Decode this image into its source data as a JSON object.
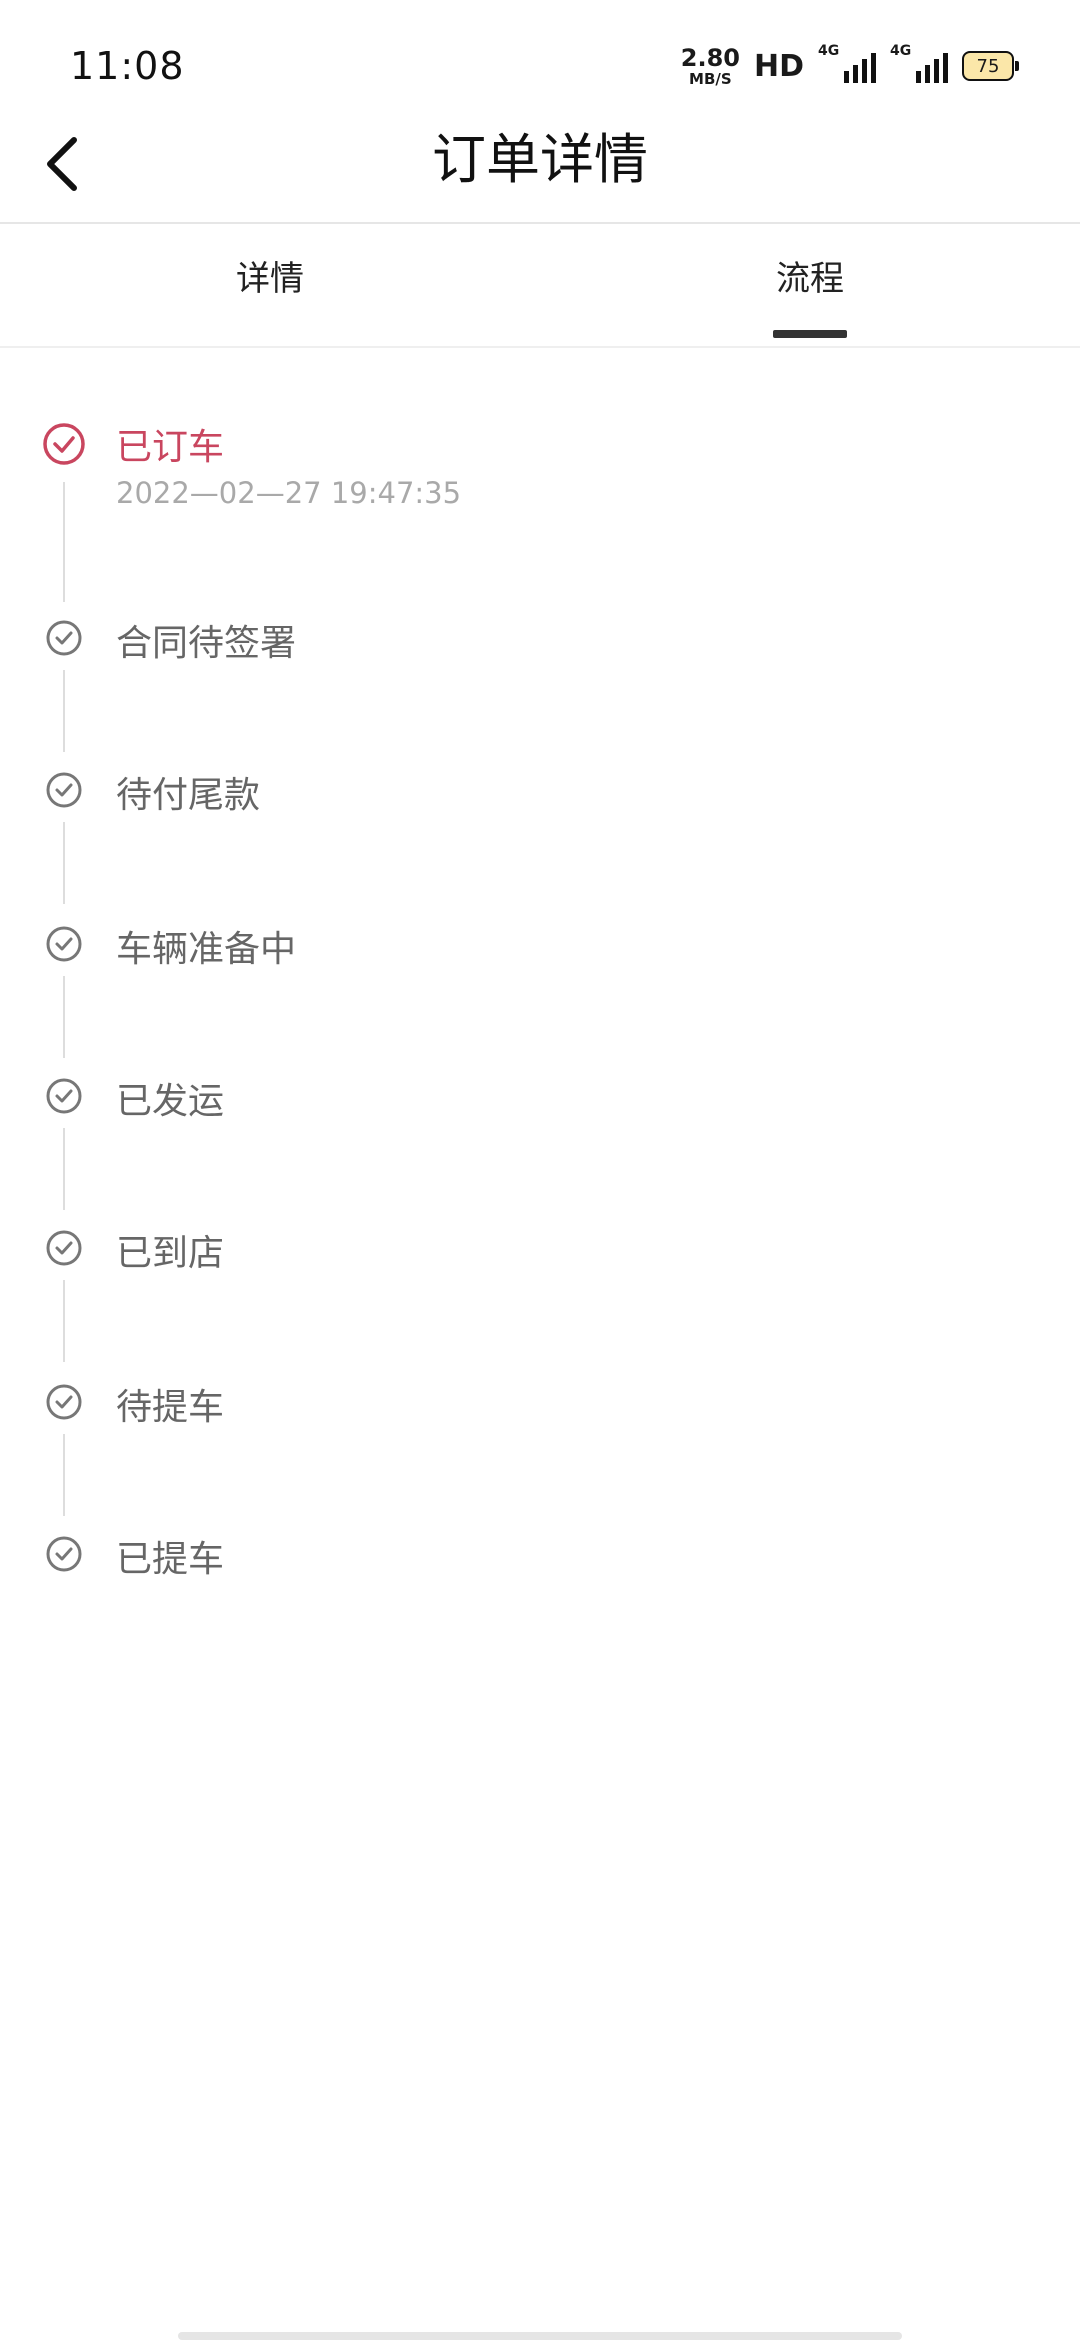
{
  "status_bar": {
    "time": "11:08",
    "net_speed_value": "2.80",
    "net_speed_unit": "MB/S",
    "hd_label": "HD",
    "signal1_label": "4G",
    "signal2_label": "4G",
    "battery_level": "75"
  },
  "header": {
    "title": "订单详情"
  },
  "tabs": [
    {
      "label": "详情",
      "active": false
    },
    {
      "label": "流程",
      "active": true
    }
  ],
  "accent_color": "#c9465f",
  "steps": [
    {
      "label": "已订车",
      "time": "2022—02—27 19:47:35",
      "active": true
    },
    {
      "label": "合同待签署",
      "active": false
    },
    {
      "label": "待付尾款",
      "active": false
    },
    {
      "label": "车辆准备中",
      "active": false
    },
    {
      "label": "已发运",
      "active": false
    },
    {
      "label": "已到店",
      "active": false
    },
    {
      "label": "待提车",
      "active": false
    },
    {
      "label": "已提车",
      "active": false
    }
  ]
}
